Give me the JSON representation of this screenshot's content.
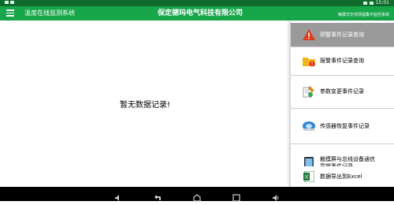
{
  "status_bar": {
    "time": "15:01"
  },
  "app_bar": {
    "title": "温度在线监测系统",
    "company": "保定德玛电气科技有限公司",
    "subtitle": "触摸式无线测温集中监控系统"
  },
  "main": {
    "empty_message": "暂无数据记录!"
  },
  "sidebar": {
    "items": [
      {
        "label": "预警事件记录查询",
        "icon": "warning-triangle-icon"
      },
      {
        "label": "报警事件记录查询",
        "icon": "alarm-folder-icon"
      },
      {
        "label": "参数变更事件记录",
        "icon": "parameter-edit-icon"
      },
      {
        "label": "传感器恢复事件记录",
        "icon": "sensor-restore-icon"
      },
      {
        "label": "触摸屏与总线设备通信异常事件记录",
        "icon": "communication-error-icon"
      },
      {
        "label": "数据导出到Excel",
        "icon": "excel-icon"
      }
    ]
  },
  "colors": {
    "status_bar": "#0f6a2c",
    "app_bar": "#17a64a",
    "active_item": "#9a9a9a",
    "nav_bar": "#000000"
  }
}
